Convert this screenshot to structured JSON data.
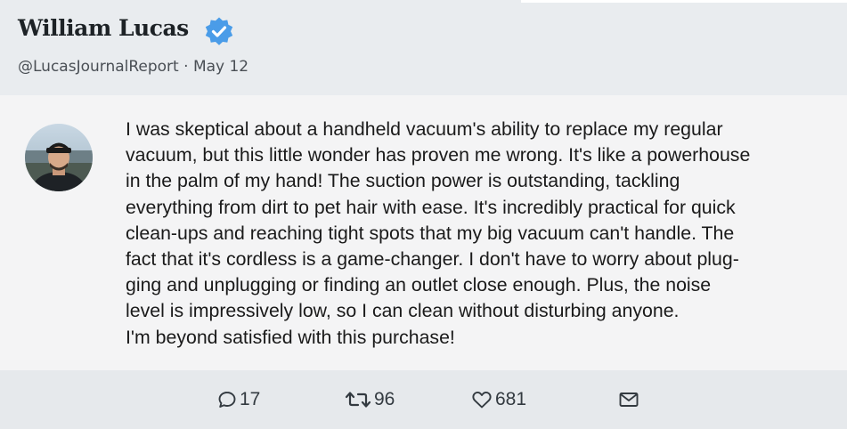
{
  "author": {
    "name": "William Lucas",
    "handle": "@LucasJournalReport",
    "date_separator": "·",
    "date": "May 12",
    "verified_icon": "verified-badge-icon",
    "badge_color": "#4a9ce8"
  },
  "tweet": {
    "lines": [
      "I was skeptical about a handheld vacuum's ability to replace my regular",
      "vacuum, but this little wonder has proven me wrong. It's like a powerhouse",
      "in the palm of my hand! The suction power is outstanding, tackling",
      "everything from dirt to pet hair with ease. It's incredibly practical for quick",
      "clean-ups and reaching tight spots that my big vacuum can't handle. The",
      "fact that it's cordless is a game-changer. I don't have to worry about plug-",
      "ging and unplugging or finding an outlet close enough. Plus, the noise",
      "level is impressively low, so I can clean without disturbing anyone.",
      "I'm beyond satisfied with this purchase!"
    ]
  },
  "actions": {
    "replies": {
      "icon": "comment-icon",
      "count": "17"
    },
    "retweets": {
      "icon": "retweet-icon",
      "count": "96"
    },
    "likes": {
      "icon": "heart-icon",
      "count": "681"
    },
    "share": {
      "icon": "mail-icon"
    }
  }
}
